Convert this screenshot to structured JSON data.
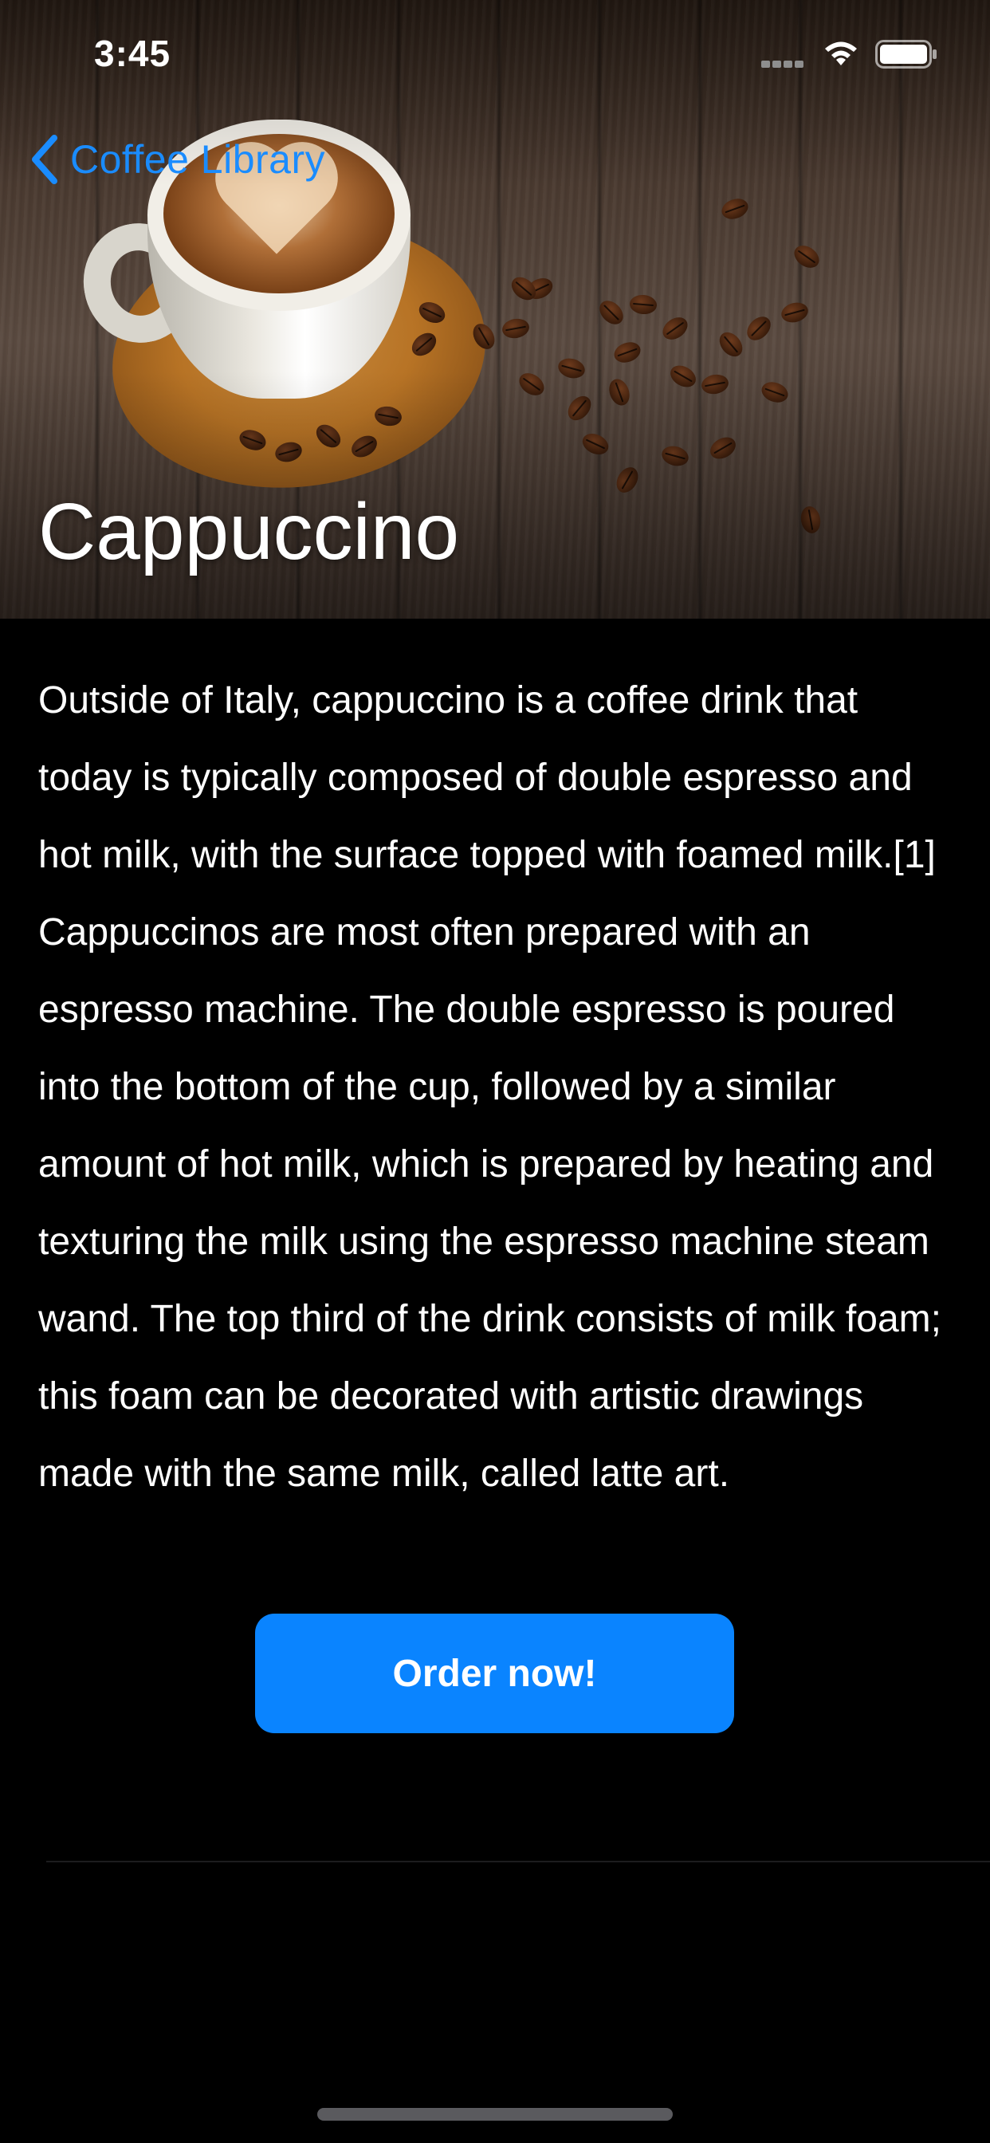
{
  "status_bar": {
    "time": "3:45"
  },
  "nav": {
    "back_label": "Coffee Library"
  },
  "detail": {
    "title": "Cappuccino",
    "description": "Outside of Italy, cappuccino is a coffee drink that today is typically composed of double espresso and hot milk, with the surface topped with foamed milk.[1] Cappuccinos are most often prepared with an espresso machine. The double espresso is poured into the bottom of the cup, followed by a similar amount of hot milk, which is prepared by heating and texturing the milk using the espresso machine steam wand. The top third of the drink consists of milk foam; this foam can be decorated with artistic drawings made with the same milk, called latte art."
  },
  "actions": {
    "order_label": "Order now!"
  },
  "colors": {
    "accent": "#0a84ff",
    "back_link": "#1a8cff",
    "background": "#000000"
  }
}
